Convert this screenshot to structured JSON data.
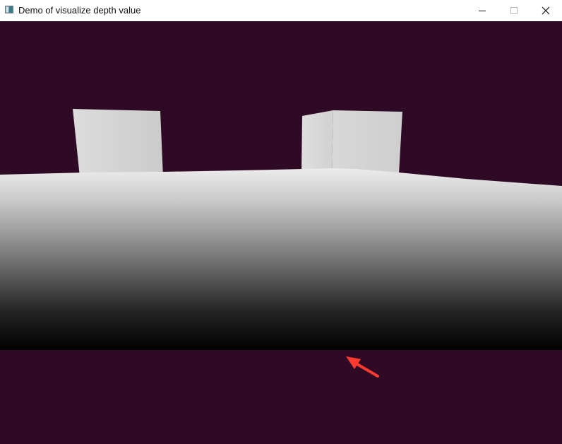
{
  "window": {
    "title": "Demo of visualize depth value",
    "controls": {
      "minimize_icon": "minimize-icon",
      "maximize_icon": "maximize-icon",
      "close_icon": "close-icon"
    }
  },
  "colors": {
    "background": "#2e0a24",
    "plane_near": "#000000",
    "plane_far": "#e6e6e6",
    "cube": "#d3d3d3",
    "arrow": "#ff3b30"
  },
  "scene": {
    "objects": [
      "cube-left",
      "cube-right",
      "depth-plane",
      "annotation-arrow"
    ]
  }
}
